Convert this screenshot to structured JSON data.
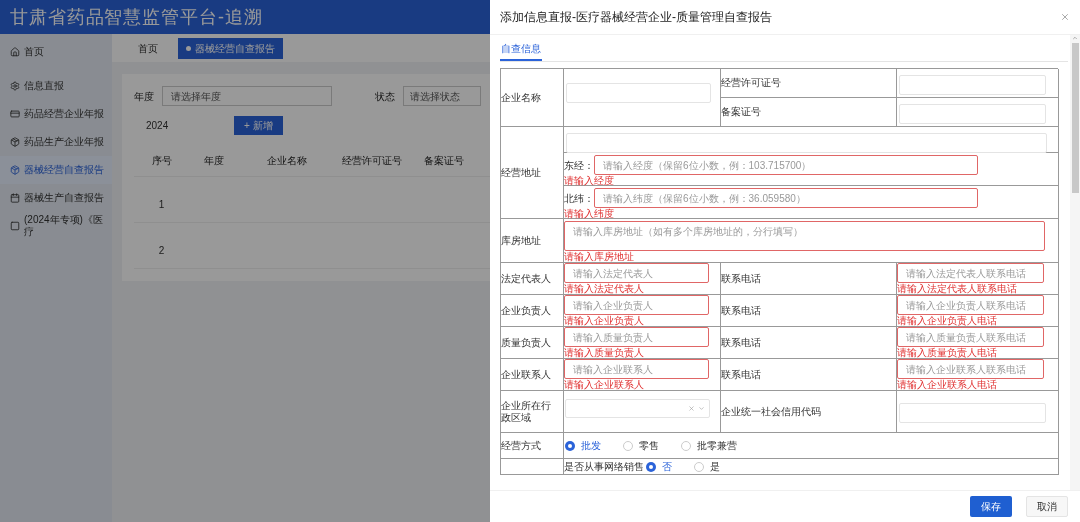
{
  "app": {
    "title": "甘肃省药品智慧监管平台-追溯"
  },
  "sidebar": {
    "items": [
      {
        "label": "首页",
        "selected": false
      },
      {
        "label": "信息直报",
        "selected": false,
        "children": [
          {
            "label": "药品经营企业年报",
            "selected": false
          },
          {
            "label": "药品生产企业年报",
            "selected": false
          },
          {
            "label": "器械经营自查报告",
            "selected": true
          },
          {
            "label": "器械生产自查报告",
            "selected": false
          },
          {
            "label": "(2024年专项)《医疗",
            "selected": false
          }
        ]
      }
    ]
  },
  "page_tabs": [
    {
      "label": "首页",
      "selected": false
    },
    {
      "label": "器械经营自查报告",
      "selected": true
    }
  ],
  "filters": {
    "year_label": "年度",
    "year_placeholder": "请选择年度",
    "status_label": "状态",
    "status_placeholder": "请选择状态",
    "year_value": "2024",
    "add_button": "+ 新增"
  },
  "table": {
    "columns": [
      "序号",
      "年度",
      "企业名称",
      "经营许可证号",
      "备案证号"
    ],
    "rows": [
      {
        "cells": [
          "1"
        ]
      },
      {
        "cells": [
          "2"
        ]
      }
    ]
  },
  "modal": {
    "title": "添加信息直报-医疗器械经营企业-质量管理自查报告",
    "tabs": [
      {
        "label": "自查信息",
        "selected": true
      }
    ],
    "company": {
      "label": "企业名称",
      "license_label": "经营许可证号",
      "record_label": "备案证号"
    },
    "address": {
      "label": "经营地址",
      "coords": [
        {
          "prefix": "东经：",
          "placeholder": "请输入经度（保留6位小数，例：103.715700）",
          "error": "请输入经度"
        },
        {
          "prefix": "北纬：",
          "placeholder": "请输入纬度（保留6位小数，例：36.059580）",
          "error": "请输入纬度"
        }
      ]
    },
    "warehouse": {
      "label": "库房地址",
      "placeholder": "请输入库房地址（如有多个库房地址的，分行填写）",
      "error": "请输入库房地址"
    },
    "contacts": [
      {
        "label": "法定代表人",
        "placeholder": "请输入法定代表人",
        "error": "请输入法定代表人",
        "phone_label": "联系电话",
        "phone_placeholder": "请输入法定代表人联系电话",
        "phone_error": "请输入法定代表人联系电话"
      },
      {
        "label": "企业负责人",
        "placeholder": "请输入企业负责人",
        "error": "请输入企业负责人",
        "phone_label": "联系电话",
        "phone_placeholder": "请输入企业负责人联系电话",
        "phone_error": "请输入企业负责人电话"
      },
      {
        "label": "质量负责人",
        "placeholder": "请输入质量负责人",
        "error": "请输入质量负责人",
        "phone_label": "联系电话",
        "phone_placeholder": "请输入质量负责人联系电话",
        "phone_error": "请输入质量负责人电话"
      },
      {
        "label": "企业联系人",
        "placeholder": "请输入企业联系人",
        "error": "请输入企业联系人",
        "phone_label": "联系电话",
        "phone_placeholder": "请输入企业联系人联系电话",
        "phone_error": "请输入企业联系人电话"
      }
    ],
    "region": {
      "label": "企业所在行政区域",
      "credit_label": "企业统一社会信用代码"
    },
    "methods": {
      "label": "经营方式",
      "options": [
        {
          "label": "批发",
          "selected": true
        },
        {
          "label": "零售",
          "selected": false
        },
        {
          "label": "批零兼营",
          "selected": false
        }
      ]
    },
    "online": {
      "label": "是否从事网络销售",
      "options": [
        {
          "label": "否",
          "selected": true
        },
        {
          "label": "是",
          "selected": false
        }
      ]
    },
    "buttons": [
      {
        "label": "保存",
        "kind": "primary"
      },
      {
        "label": "取消",
        "kind": "plain"
      }
    ]
  }
}
